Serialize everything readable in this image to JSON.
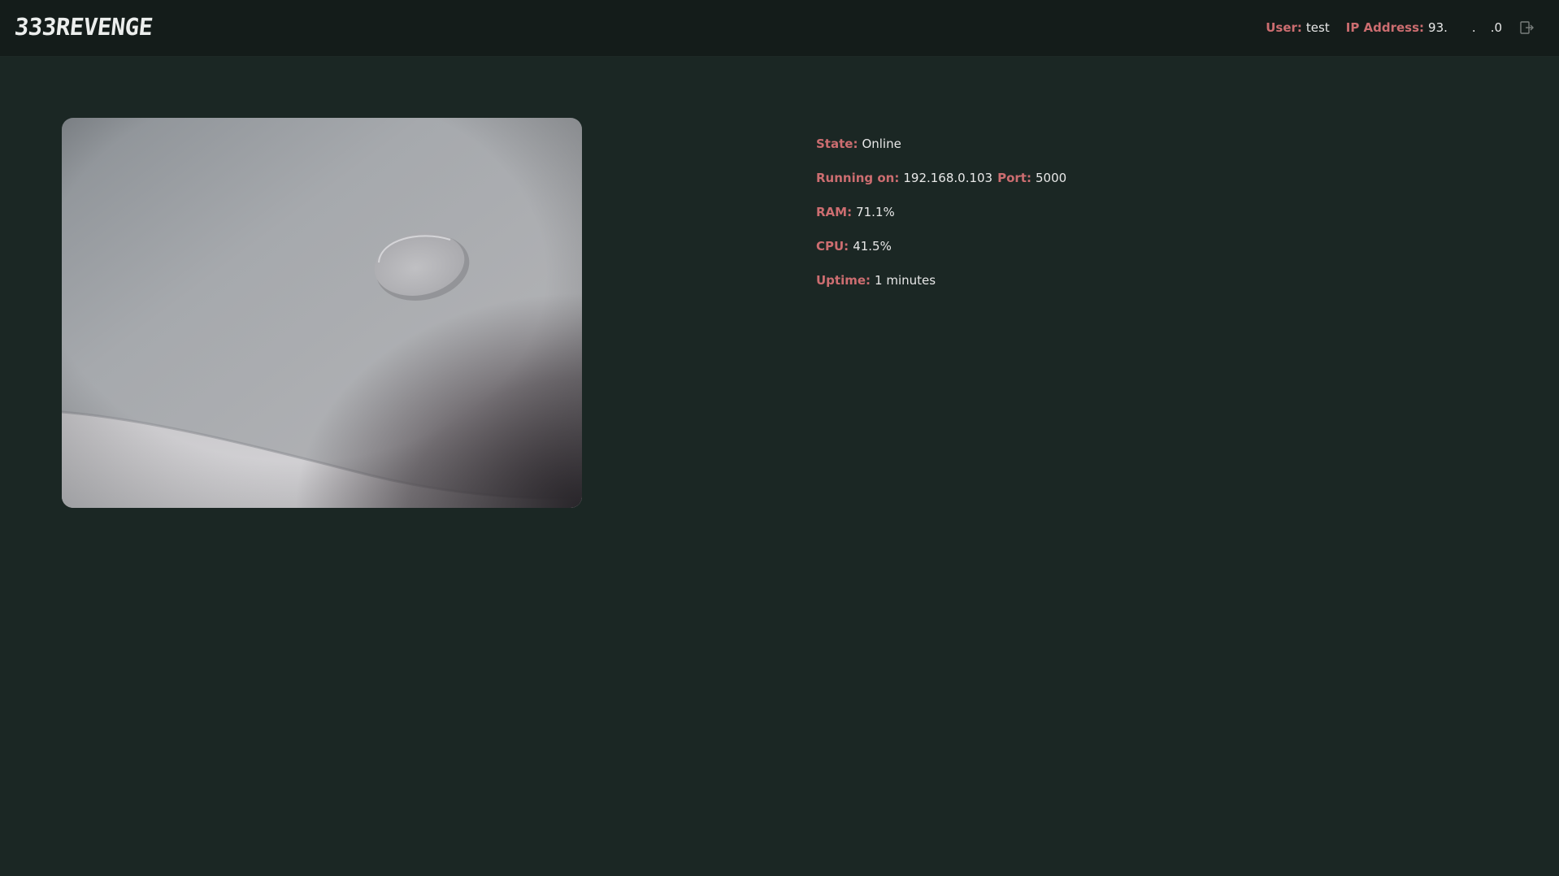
{
  "header": {
    "logo_text": "333REVENGE",
    "user_label": "User:",
    "user_value": "test",
    "ip_label": "IP Address:",
    "ip_value_start": "93.",
    "ip_value_mid": ".",
    "ip_value_end": ".0",
    "logout_icon": "logout-icon"
  },
  "camera": {
    "feed_icon": "camera-feed"
  },
  "status": {
    "state_label": "State:",
    "state_value": "Online",
    "running_label": "Running on:",
    "running_value": "192.168.0.103",
    "port_label": "Port:",
    "port_value": "5000",
    "ram_label": "RAM:",
    "ram_value": "71.1%",
    "cpu_label": "CPU:",
    "cpu_value": "41.5%",
    "uptime_label": "Uptime:",
    "uptime_value": "1 minutes"
  },
  "colors": {
    "background": "#1b2724",
    "topbar": "#141c1a",
    "label_accent": "#cc6d70",
    "text": "#e8e8e8"
  }
}
